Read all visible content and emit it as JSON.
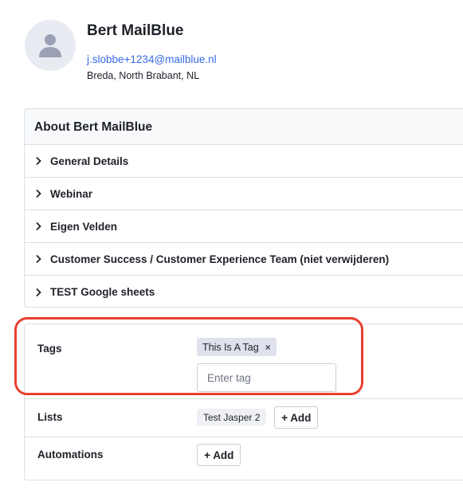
{
  "contact": {
    "name": "Bert MailBlue",
    "email": "j.slobbe+1234@mailblue.nl",
    "location": "Breda, North Brabant, NL"
  },
  "about": {
    "title": "About Bert MailBlue",
    "sections": [
      "General Details",
      "Webinar",
      "Eigen Velden",
      "Customer Success / Customer Experience Team (niet verwijderen)",
      "TEST Google sheets"
    ]
  },
  "tags": {
    "label": "Tags",
    "items": [
      "This Is A Tag"
    ],
    "remove_glyph": "×",
    "input_placeholder": "Enter tag"
  },
  "lists": {
    "label": "Lists",
    "items": [
      "Test Jasper 2"
    ],
    "add_label": "Add"
  },
  "automations": {
    "label": "Automations",
    "add_label": "Add"
  },
  "icons": {
    "avatar": "person-icon",
    "section_toggle": "chevron-right-icon",
    "tag_remove": "close-icon",
    "add": "plus-icon"
  },
  "colors": {
    "link": "#356ae6",
    "highlight": "#e8402f",
    "tag_bg": "#dfe2ec"
  }
}
